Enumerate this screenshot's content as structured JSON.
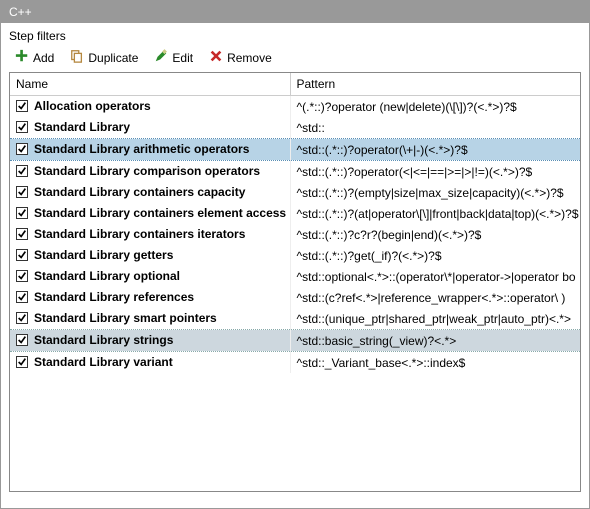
{
  "title": "C++",
  "section_label": "Step filters",
  "toolbar": {
    "add": "Add",
    "duplicate": "Duplicate",
    "edit": "Edit",
    "remove": "Remove"
  },
  "columns": {
    "name": "Name",
    "pattern": "Pattern"
  },
  "rows": [
    {
      "name": "Allocation operators",
      "pattern": "^(.*::)?operator (new|delete)(\\[\\])?(<.*>)?$",
      "sel": ""
    },
    {
      "name": "Standard Library",
      "pattern": "^std::",
      "sel": ""
    },
    {
      "name": "Standard Library arithmetic operators",
      "pattern": "^std::(.*::)?operator(\\+|-)(<.*>)?$",
      "sel": "selected"
    },
    {
      "name": "Standard Library comparison operators",
      "pattern": "^std::(.*::)?operator(<|<=|==|>=|>|!=)(<.*>)?$",
      "sel": ""
    },
    {
      "name": "Standard Library containers capacity",
      "pattern": "^std::(.*::)?(empty|size|max_size|capacity)(<.*>)?$",
      "sel": ""
    },
    {
      "name": "Standard Library containers element access",
      "pattern": "^std::(.*::)?(at|operator\\[\\]|front|back|data|top)(<.*>)?$",
      "sel": ""
    },
    {
      "name": "Standard Library containers iterators",
      "pattern": "^std::(.*::)?c?r?(begin|end)(<.*>)?$",
      "sel": ""
    },
    {
      "name": "Standard Library getters",
      "pattern": "^std::(.*::)?get(_if)?(<.*>)?$",
      "sel": ""
    },
    {
      "name": "Standard Library optional",
      "pattern": "^std::optional<.*>::(operator\\*|operator->|operator bo",
      "sel": ""
    },
    {
      "name": "Standard Library references",
      "pattern": "^std::(c?ref<.*>|reference_wrapper<.*>::operator\\ )",
      "sel": ""
    },
    {
      "name": "Standard Library smart pointers",
      "pattern": "^std::(unique_ptr|shared_ptr|weak_ptr|auto_ptr)<.*>",
      "sel": ""
    },
    {
      "name": "Standard Library strings",
      "pattern": "^std::basic_string(_view)?<.*>",
      "sel": "selectedF"
    },
    {
      "name": "Standard Library variant",
      "pattern": "^std::_Variant_base<.*>::index$",
      "sel": ""
    }
  ]
}
